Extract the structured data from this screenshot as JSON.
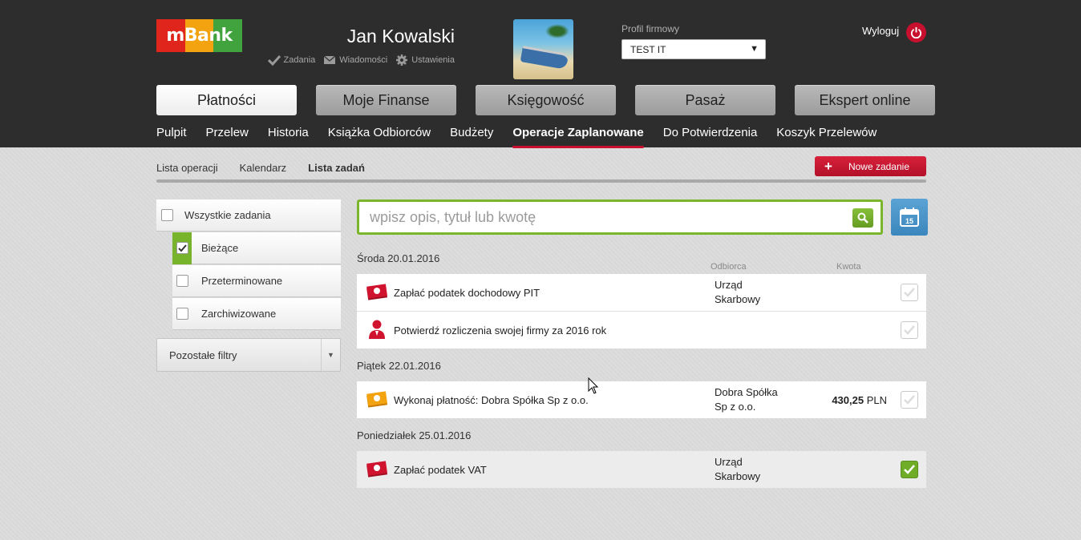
{
  "brand": {
    "logo_text": "mBank",
    "red": "#e0261c",
    "orange": "#f2a30f",
    "green": "#40a33d",
    "accent": "#c8102e"
  },
  "user": {
    "name": "Jan Kowalski",
    "links": [
      {
        "label": "Zadania",
        "icon": "checkmark-icon"
      },
      {
        "label": "Wiadomości",
        "icon": "envelope-icon"
      },
      {
        "label": "Ustawienia",
        "icon": "gear-icon"
      }
    ]
  },
  "profile": {
    "label": "Profil firmowy",
    "selected": "TEST IT"
  },
  "logout": {
    "label": "Wyloguj",
    "icon": "power-icon"
  },
  "main_tabs": [
    {
      "label": "Płatności",
      "active": true
    },
    {
      "label": "Moje Finanse",
      "active": false
    },
    {
      "label": "Księgowość",
      "active": false
    },
    {
      "label": "Pasaż",
      "active": false
    },
    {
      "label": "Ekspert online",
      "active": false
    }
  ],
  "sub_nav": [
    {
      "label": "Pulpit"
    },
    {
      "label": "Przelew"
    },
    {
      "label": "Historia"
    },
    {
      "label": "Książka Odbiorców"
    },
    {
      "label": "Budżety"
    },
    {
      "label": "Operacje Zaplanowane",
      "active": true
    },
    {
      "label": "Do Potwierdzenia"
    },
    {
      "label": "Koszyk Przelewów"
    }
  ],
  "view_tabs": [
    {
      "label": "Lista operacji"
    },
    {
      "label": "Kalendarz"
    },
    {
      "label": "Lista zadań",
      "active": true
    }
  ],
  "new_task_button": {
    "plus": "+",
    "label": "Nowe zadanie"
  },
  "filters": {
    "all": {
      "label": "Wszystkie zadania",
      "checked": false
    },
    "items": [
      {
        "label": "Bieżące",
        "checked": true
      },
      {
        "label": "Przeterminowane",
        "checked": false
      },
      {
        "label": "Zarchiwizowane",
        "checked": false
      }
    ],
    "more": {
      "label": "Pozostałe filtry"
    }
  },
  "search": {
    "placeholder": "wpisz opis, tytuł lub kwotę",
    "value": ""
  },
  "calendar_button": {
    "day": "15"
  },
  "columns": {
    "recipient": "Odbiorca",
    "amount": "Kwota"
  },
  "days": [
    {
      "label": "Środa 20.01.2016",
      "tasks": [
        {
          "title": "Zapłać podatek dochodowy PIT",
          "recipient_line1": "Urząd",
          "recipient_line2": "Skarbowy",
          "amount": "",
          "currency": "",
          "icon": "tax-payment-icon",
          "done": false
        },
        {
          "title": "Potwierdź rozliczenia swojej firmy za 2016 rok",
          "recipient_line1": "",
          "recipient_line2": "",
          "amount": "",
          "currency": "",
          "icon": "person-icon",
          "done": false
        }
      ]
    },
    {
      "label": "Piątek 22.01.2016",
      "tasks": [
        {
          "title": "Wykonaj płatność: Dobra Spółka Sp z o.o.",
          "recipient_line1": "Dobra Spółka",
          "recipient_line2": "Sp z o.o.",
          "amount": "430,25",
          "currency": "PLN",
          "icon": "payment-icon",
          "done": false
        }
      ]
    },
    {
      "label": "Poniedziałek 25.01.2016",
      "tasks": [
        {
          "title": "Zapłać podatek VAT",
          "recipient_line1": "Urząd",
          "recipient_line2": "Skarbowy",
          "amount": "",
          "currency": "",
          "icon": "tax-payment-icon",
          "done": true
        }
      ]
    }
  ]
}
